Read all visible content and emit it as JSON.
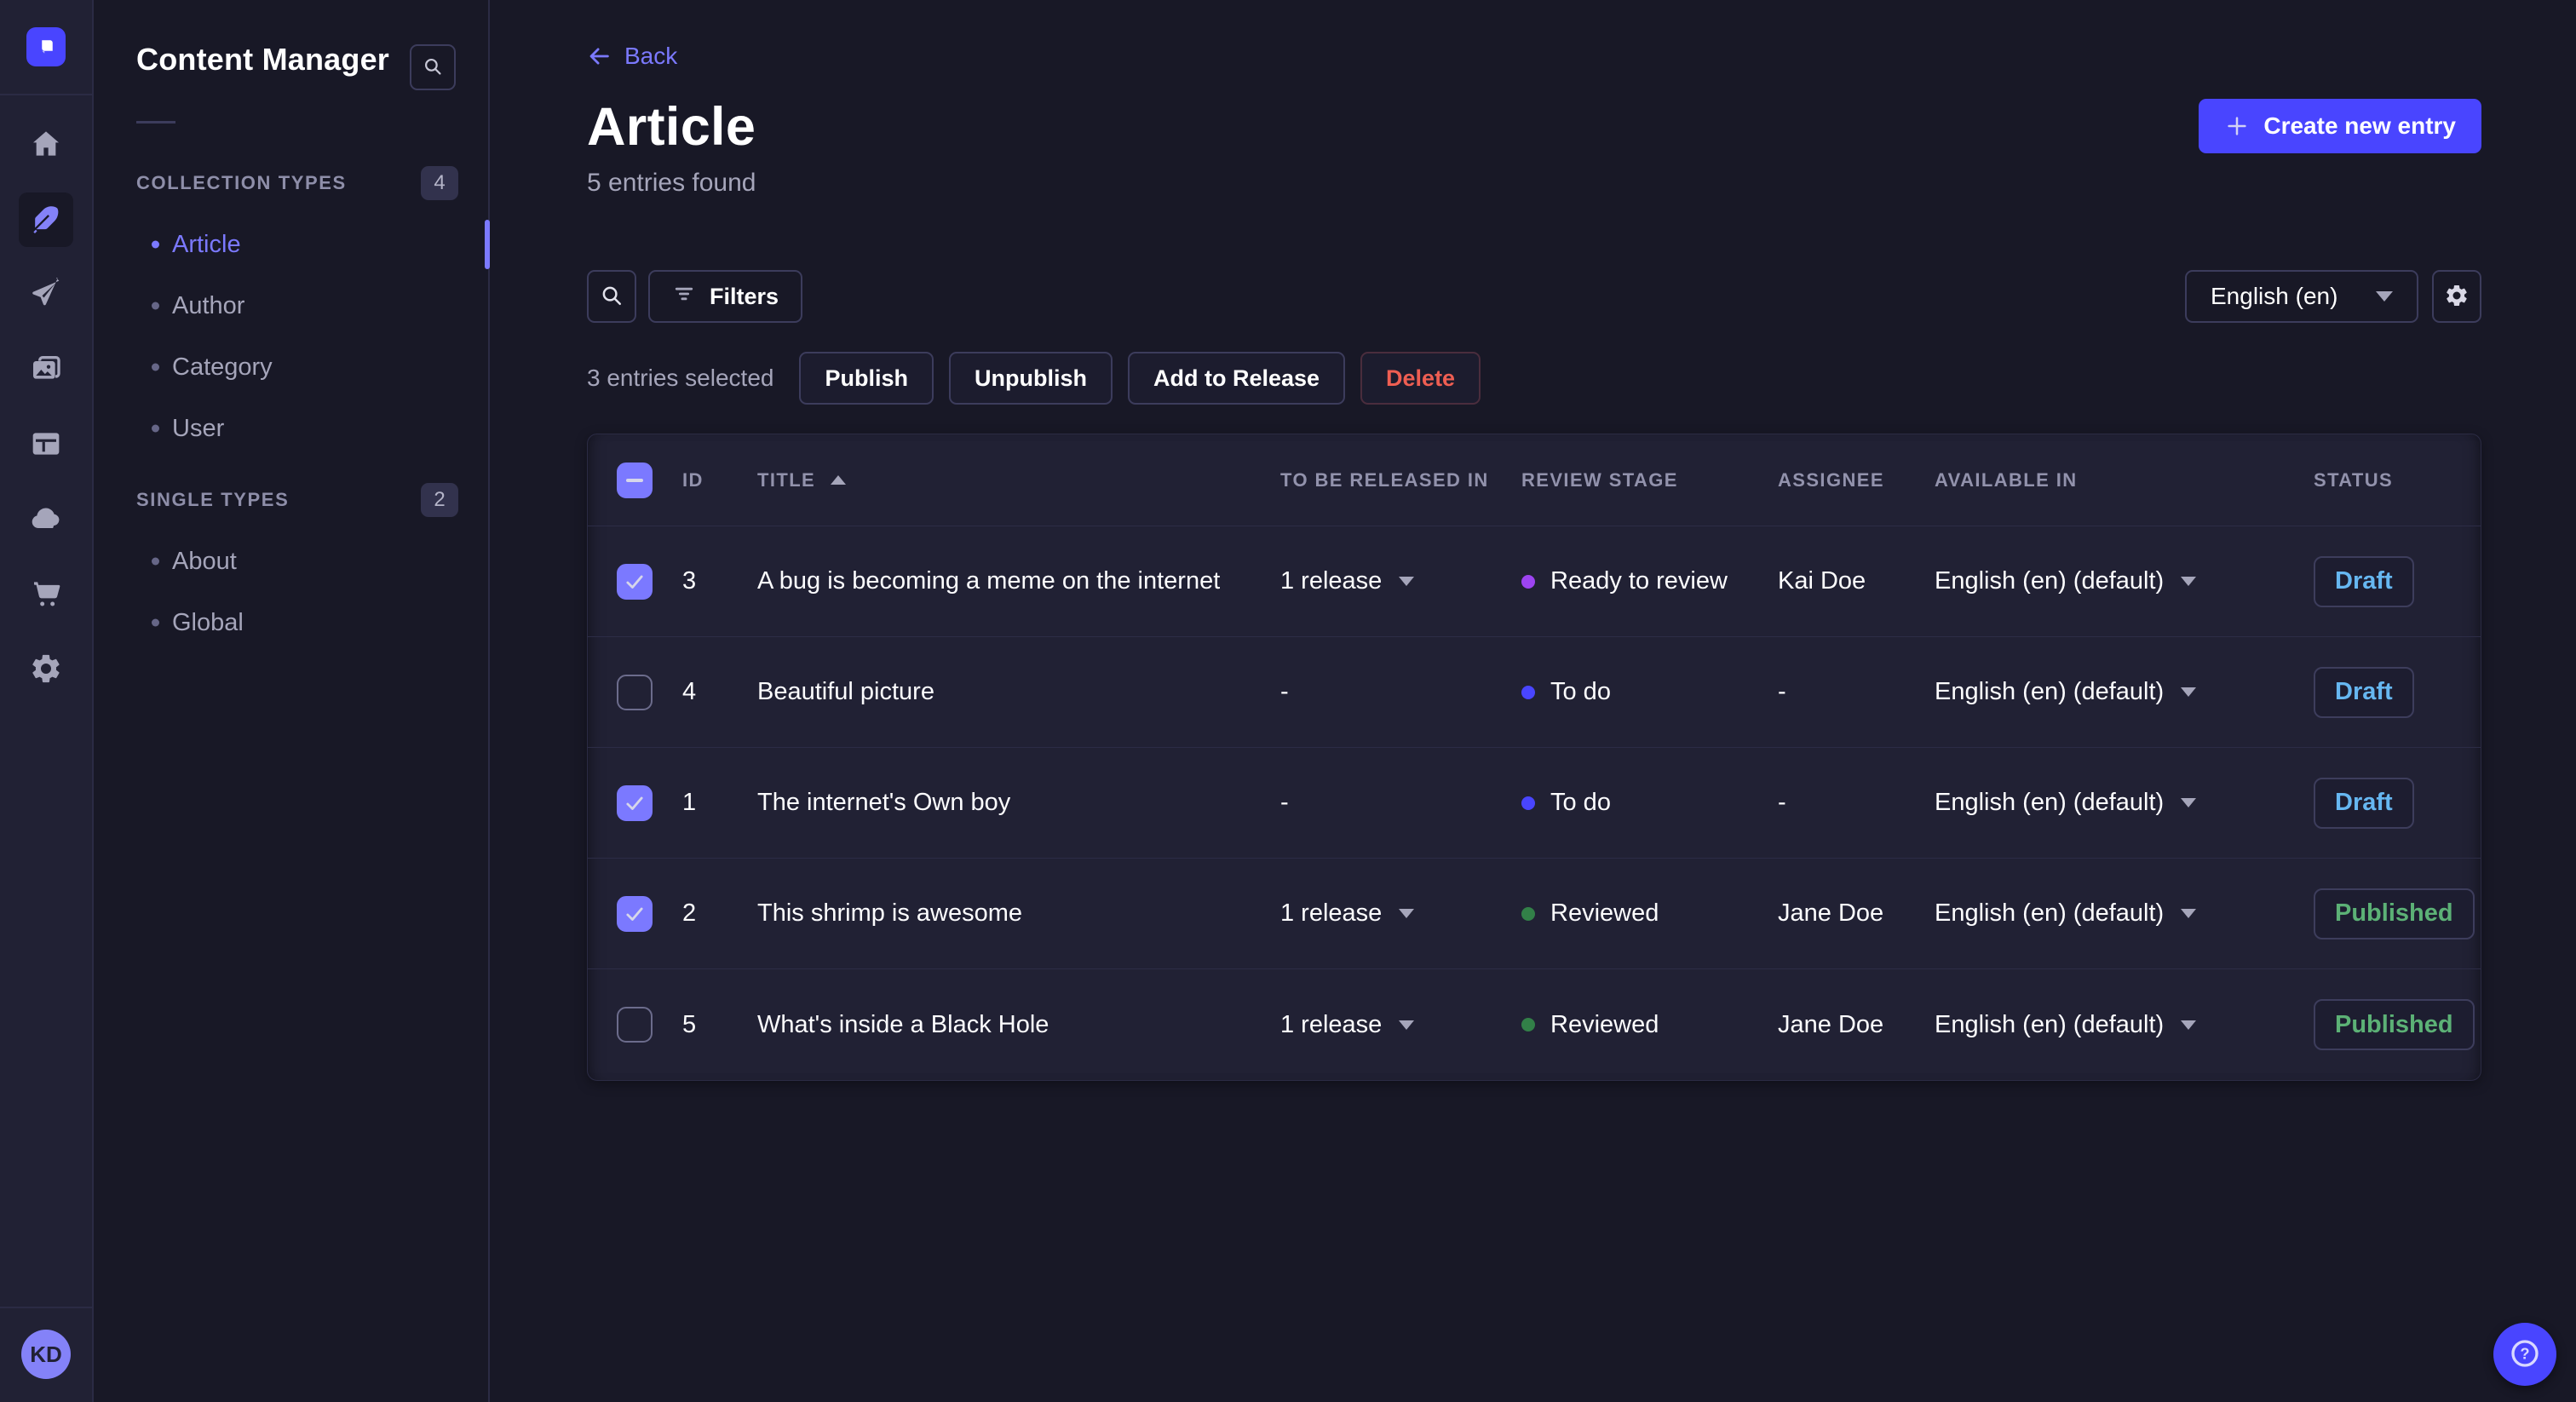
{
  "brand": {
    "primary": "#4945ff",
    "primary_light": "#7b79ff",
    "danger": "#ee5e52"
  },
  "nav_rail": {
    "items": [
      {
        "icon": "home",
        "active": false
      },
      {
        "icon": "content",
        "active": true
      },
      {
        "icon": "release",
        "active": false
      },
      {
        "icon": "media",
        "active": false
      },
      {
        "icon": "layout",
        "active": false
      },
      {
        "icon": "cloud",
        "active": false
      },
      {
        "icon": "marketplace",
        "active": false
      },
      {
        "icon": "settings",
        "active": false
      }
    ],
    "avatar_initials": "KD"
  },
  "sidebar": {
    "title": "Content Manager",
    "sections": [
      {
        "label": "COLLECTION TYPES",
        "badge": "4",
        "items": [
          {
            "label": "Article",
            "active": true
          },
          {
            "label": "Author",
            "active": false
          },
          {
            "label": "Category",
            "active": false
          },
          {
            "label": "User",
            "active": false
          }
        ]
      },
      {
        "label": "SINGLE TYPES",
        "badge": "2",
        "items": [
          {
            "label": "About",
            "active": false
          },
          {
            "label": "Global",
            "active": false
          }
        ]
      }
    ]
  },
  "header": {
    "back_label": "Back",
    "title": "Article",
    "entries_count": "5 entries found",
    "create_button_label": "Create new entry"
  },
  "toolbar": {
    "filters_label": "Filters",
    "locale_value": "English (en)"
  },
  "selection": {
    "count_label": "3 entries selected",
    "actions": [
      {
        "label": "Publish",
        "danger": false
      },
      {
        "label": "Unpublish",
        "danger": false
      },
      {
        "label": "Add to Release",
        "danger": false
      },
      {
        "label": "Delete",
        "danger": true
      }
    ]
  },
  "table": {
    "columns": [
      "ID",
      "TITLE",
      "TO BE RELEASED IN",
      "REVIEW STAGE",
      "ASSIGNEE",
      "AVAILABLE IN",
      "STATUS"
    ],
    "sort": {
      "column": "TITLE",
      "direction": "asc"
    },
    "rows": [
      {
        "selected": true,
        "id": "3",
        "title": "A bug is becoming a meme on the internet",
        "to_be_released_in": "1 release",
        "review_stage": {
          "label": "Ready to review",
          "color": "#9d44f1"
        },
        "assignee": "Kai Doe",
        "available_in": "English (en) (default)",
        "status": {
          "label": "Draft",
          "color": "#66b7f1"
        }
      },
      {
        "selected": false,
        "id": "4",
        "title": "Beautiful picture",
        "to_be_released_in": "-",
        "review_stage": {
          "label": "To do",
          "color": "#4945ff"
        },
        "assignee": "-",
        "available_in": "English (en) (default)",
        "status": {
          "label": "Draft",
          "color": "#66b7f1"
        }
      },
      {
        "selected": true,
        "id": "1",
        "title": "The internet's Own boy",
        "to_be_released_in": "-",
        "review_stage": {
          "label": "To do",
          "color": "#4945ff"
        },
        "assignee": "-",
        "available_in": "English (en) (default)",
        "status": {
          "label": "Draft",
          "color": "#66b7f1"
        }
      },
      {
        "selected": true,
        "id": "2",
        "title": "This shrimp is awesome",
        "to_be_released_in": "1 release",
        "review_stage": {
          "label": "Reviewed",
          "color": "#328048"
        },
        "assignee": "Jane Doe",
        "available_in": "English (en) (default)",
        "status": {
          "label": "Published",
          "color": "#5cb176"
        }
      },
      {
        "selected": false,
        "id": "5",
        "title": "What's inside a Black Hole",
        "to_be_released_in": "1 release",
        "review_stage": {
          "label": "Reviewed",
          "color": "#328048"
        },
        "assignee": "Jane Doe",
        "available_in": "English (en) (default)",
        "status": {
          "label": "Published",
          "color": "#5cb176"
        }
      }
    ]
  }
}
